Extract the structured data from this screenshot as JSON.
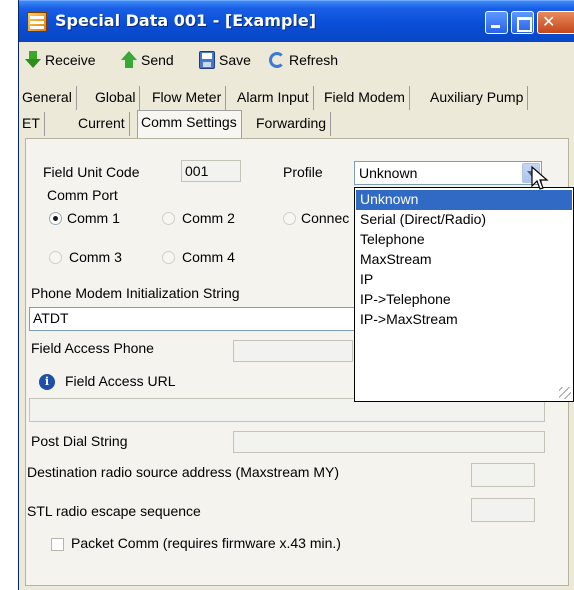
{
  "window": {
    "title": "Special Data 001 - [Example]"
  },
  "toolbar": {
    "receive": "Receive",
    "send": "Send",
    "save": "Save",
    "refresh": "Refresh"
  },
  "tabs": {
    "row1": [
      "General",
      "Global",
      "Flow Meter",
      "Alarm Input",
      "Field Modem",
      "Auxiliary Pump"
    ],
    "row2": [
      "ET",
      "Current",
      "Comm Settings",
      "Forwarding"
    ],
    "active": "Comm Settings"
  },
  "form": {
    "field_unit_code_label": "Field Unit Code",
    "field_unit_code_value": "001",
    "profile_label": "Profile",
    "profile_value": "Unknown",
    "comm_port_label": "Comm Port",
    "comm1": "Comm 1",
    "comm2": "Comm 2",
    "comm3": "Comm 3",
    "comm4": "Comm 4",
    "connect_partial": "Connec",
    "phone_init_label": "Phone Modem Initialization String",
    "phone_init_value": "ATDT",
    "field_access_phone_label": "Field Access Phone",
    "field_access_phone_value": "",
    "field_access_url_label": "Field Access URL",
    "field_access_url_value": "",
    "post_dial_label": "Post Dial String",
    "post_dial_value": "",
    "dest_radio_label": "Destination radio source address (Maxstream MY)",
    "dest_radio_value": "",
    "stl_escape_label": "STL radio escape sequence",
    "stl_escape_value": "",
    "packet_comm_label": "Packet Comm (requires firmware x.43 min.)"
  },
  "profile_dropdown": {
    "options": [
      "Unknown",
      "Serial (Direct/Radio)",
      "Telephone",
      "MaxStream",
      "IP",
      "IP->Telephone",
      "IP->MaxStream"
    ],
    "selected_index": 0
  },
  "colors": {
    "titlebar": "#0a4fd8",
    "selection": "#316ac5",
    "window_bg": "#ece9d8"
  }
}
